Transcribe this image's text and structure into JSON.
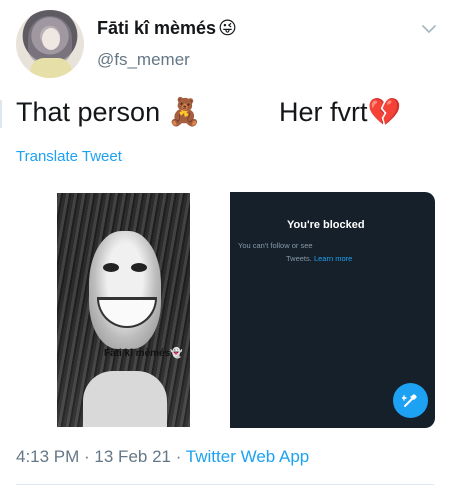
{
  "author": {
    "display_name": "Fāti kî mèmés",
    "name_emoji": "😜",
    "handle": "@fs_memer"
  },
  "tweet": {
    "left_text": "That person 🧸",
    "right_text": "Her fvrt💔",
    "translate_label": "Translate Tweet"
  },
  "media": {
    "left_watermark": "Fāti kî mèmés",
    "left_watermark_emoji": "👻",
    "right_title": "You're blocked",
    "right_body_line1": "You can't follow or see",
    "right_body_line2_prefix": "Tweets.",
    "right_body_link": "Learn more"
  },
  "meta": {
    "time": "4:13 PM",
    "sep1": " · ",
    "date": "13 Feb 21",
    "sep2": " · ",
    "app": "Twitter Web App"
  },
  "colors": {
    "accent": "#1da1f2",
    "secondary_text": "#657786",
    "dark_bg": "#15202b"
  }
}
